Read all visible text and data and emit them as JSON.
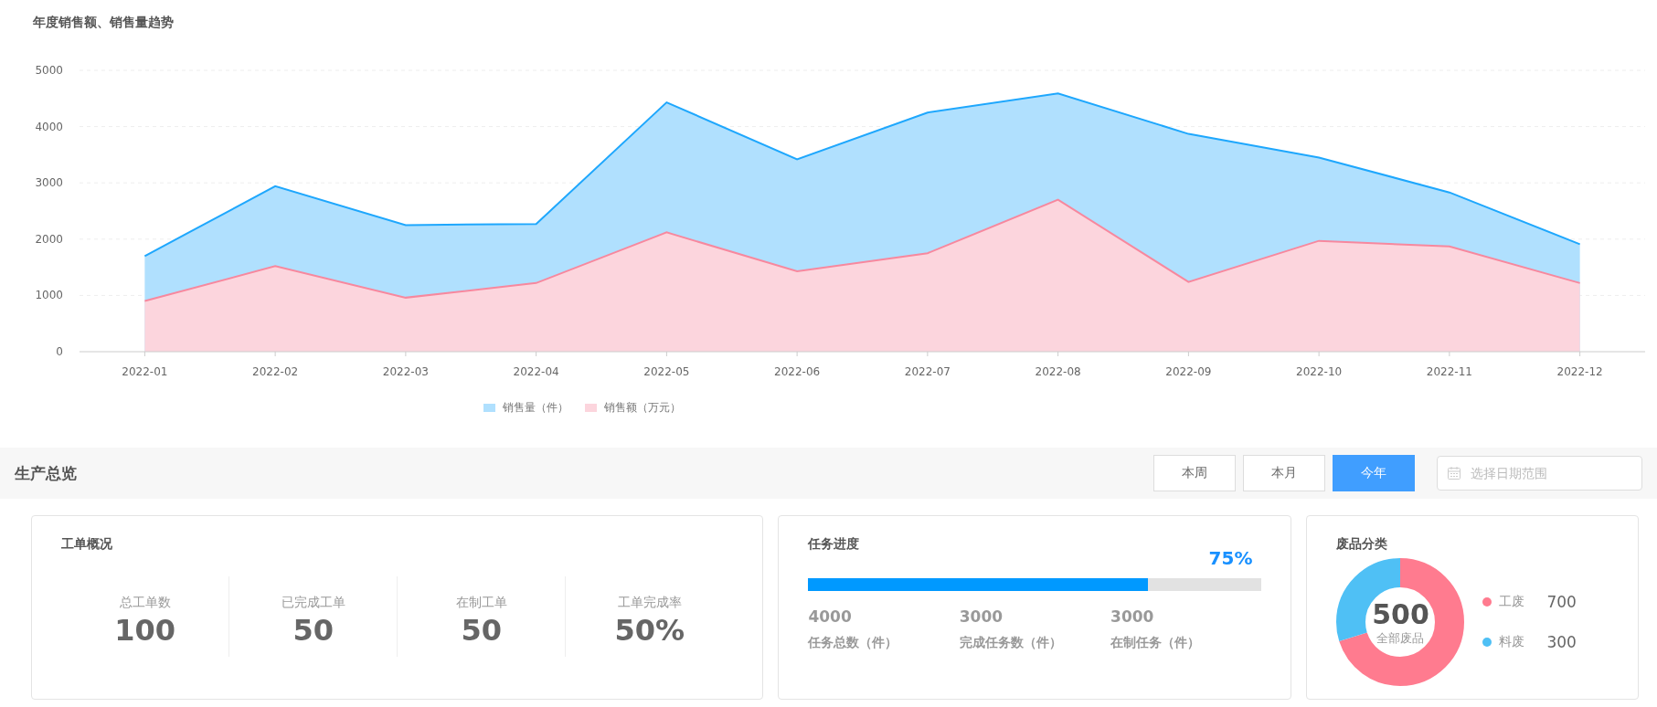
{
  "sales_chart": {
    "title": "年度销售额、销售量趋势",
    "chart_data": {
      "type": "area",
      "categories": [
        "2022-01",
        "2022-02",
        "2022-03",
        "2022-04",
        "2022-05",
        "2022-06",
        "2022-07",
        "2022-08",
        "2022-09",
        "2022-10",
        "2022-11",
        "2022-12"
      ],
      "series": [
        {
          "name": "销售量（件）",
          "color": "#1ea7fd",
          "values": [
            1700,
            2940,
            2250,
            2270,
            4430,
            3420,
            4250,
            4590,
            3870,
            3450,
            2830,
            1910
          ]
        },
        {
          "name": "销售额（万元）",
          "color": "#f7889e",
          "values": [
            900,
            1520,
            960,
            1220,
            2120,
            1430,
            1750,
            2700,
            1240,
            1970,
            1870,
            1220
          ]
        }
      ],
      "ylim": [
        0,
        5000
      ],
      "yticks": [
        0,
        1000,
        2000,
        3000,
        4000,
        5000
      ],
      "stacked": false,
      "grid": true
    }
  },
  "overview": {
    "title": "生产总览",
    "periods": [
      {
        "label": "本周",
        "selected": false
      },
      {
        "label": "本月",
        "selected": false
      },
      {
        "label": "今年",
        "selected": true
      }
    ],
    "date_range": {
      "placeholder": "选择日期范围"
    }
  },
  "work_orders": {
    "title": "工单概况",
    "stats": [
      {
        "label": "总工单数",
        "value": "100"
      },
      {
        "label": "已完成工单",
        "value": "50"
      },
      {
        "label": "在制工单",
        "value": "50"
      },
      {
        "label": "工单完成率",
        "value": "50%"
      }
    ]
  },
  "task_progress": {
    "title": "任务进度",
    "percent": "75%",
    "level": 0.75,
    "stats": [
      {
        "value": "4000",
        "label": "任务总数（件）"
      },
      {
        "value": "3000",
        "label": "完成任务数（件）"
      },
      {
        "value": "3000",
        "label": "在制任务（件）"
      }
    ]
  },
  "scrap": {
    "title": "废品分类",
    "total": "500",
    "total_label": "全部废品",
    "items": [
      {
        "name": "工废",
        "value": "700",
        "color": "#ff7b8f"
      },
      {
        "name": "料废",
        "value": "300",
        "color": "#4fc0f5"
      }
    ]
  }
}
